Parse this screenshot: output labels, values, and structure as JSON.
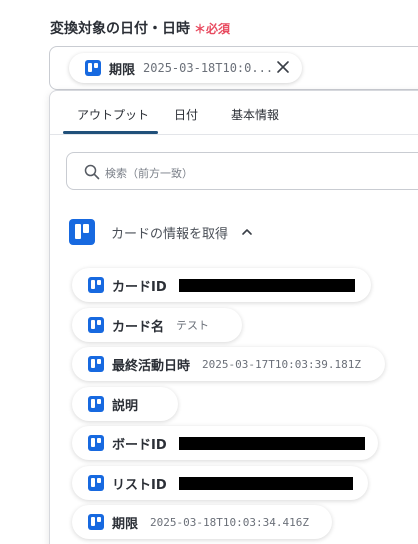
{
  "field": {
    "label": "変換対象の日付・日時",
    "required_mark": "＊",
    "required_label": "必須",
    "selected": {
      "label": "期限",
      "value": "2025-03-18T10:0..."
    }
  },
  "tabs": [
    {
      "label": "アウトプット",
      "active": true
    },
    {
      "label": "日付",
      "active": false
    },
    {
      "label": "基本情報",
      "active": false
    }
  ],
  "search": {
    "placeholder": "検索（前方一致）"
  },
  "section": {
    "title": "カードの情報を取得",
    "expanded": true
  },
  "outputs": [
    {
      "label": "カードID",
      "value": "",
      "redacted": true
    },
    {
      "label": "カード名",
      "value": "テスト",
      "redacted": false
    },
    {
      "label": "最終活動日時",
      "value": "2025-03-17T10:03:39.181Z",
      "redacted": false
    },
    {
      "label": "説明",
      "value": "",
      "redacted": false
    },
    {
      "label": "ボードID",
      "value": "",
      "redacted": true
    },
    {
      "label": "リストID",
      "value": "",
      "redacted": true
    },
    {
      "label": "期限",
      "value": "2025-03-18T10:03:34.416Z",
      "redacted": false
    }
  ],
  "colors": {
    "trello_blue": "#1769e0",
    "active_tab": "#20507a",
    "required": "#e84a5f"
  }
}
